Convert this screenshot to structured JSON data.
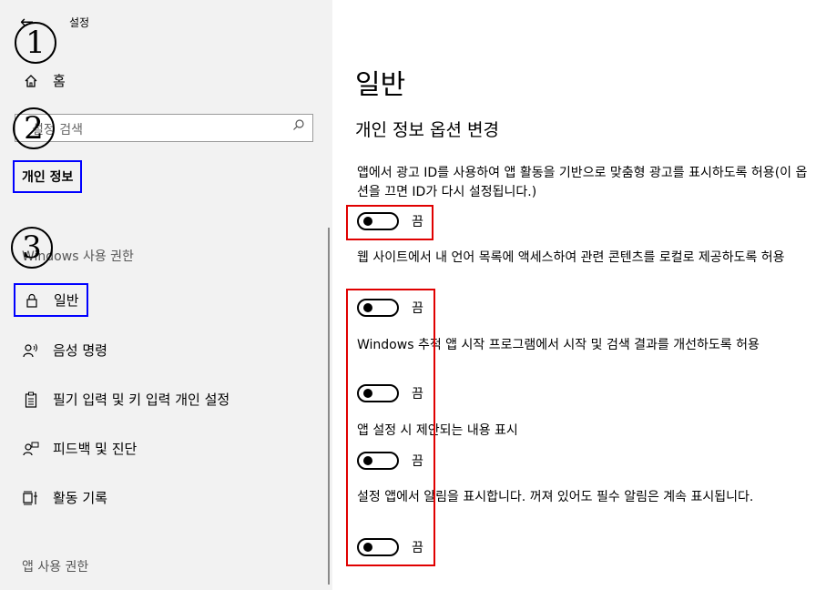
{
  "window": {
    "back_glyph": "←",
    "title": "설정"
  },
  "annotations": {
    "n1": "1",
    "n2": "2",
    "n3": "3"
  },
  "sidebar": {
    "home_label": "홈",
    "search_placeholder": "설정 검색",
    "privacy_header": "개인 정보",
    "windows_perm_header": "Windows 사용 권한",
    "items": [
      {
        "label": "일반",
        "icon": "lock-icon"
      },
      {
        "label": "음성 명령",
        "icon": "speech-icon"
      },
      {
        "label": "필기 입력 및 키 입력 개인 설정",
        "icon": "clipboard-icon"
      },
      {
        "label": "피드백 및 진단",
        "icon": "feedback-icon"
      },
      {
        "label": "활동 기록",
        "icon": "timeline-icon"
      }
    ],
    "app_perm_header": "앱 사용 권한"
  },
  "main": {
    "title": "일반",
    "subtitle": "개인 정보 옵션 변경",
    "settings": [
      {
        "desc": "앱에서 광고 ID를 사용하여 앱 활동을 기반으로 맞춤형 광고를 표시하도록 허용(이 옵션을 끄면 ID가 다시 설정됩니다.)",
        "state": "끔",
        "on": false
      },
      {
        "desc": "웹 사이트에서 내 언어 목록에 액세스하여 관련 콘텐츠를 로컬로 제공하도록 허용",
        "state": "끔",
        "on": false
      },
      {
        "desc": "Windows 추적 앱 시작 프로그램에서 시작 및 검색 결과를 개선하도록 허용",
        "state": "끔",
        "on": false
      },
      {
        "desc": "앱 설정 시 제안되는 내용 표시",
        "state": "끔",
        "on": false
      },
      {
        "desc": "설정 앱에서 알림을 표시합니다. 꺼져 있어도 필수 알림은 계속 표시됩니다.",
        "state": "끔",
        "on": false
      }
    ]
  },
  "colors": {
    "annotation_blue": "#0000ff",
    "annotation_red": "#e00000",
    "sidebar_bg": "#f2f2f2"
  }
}
